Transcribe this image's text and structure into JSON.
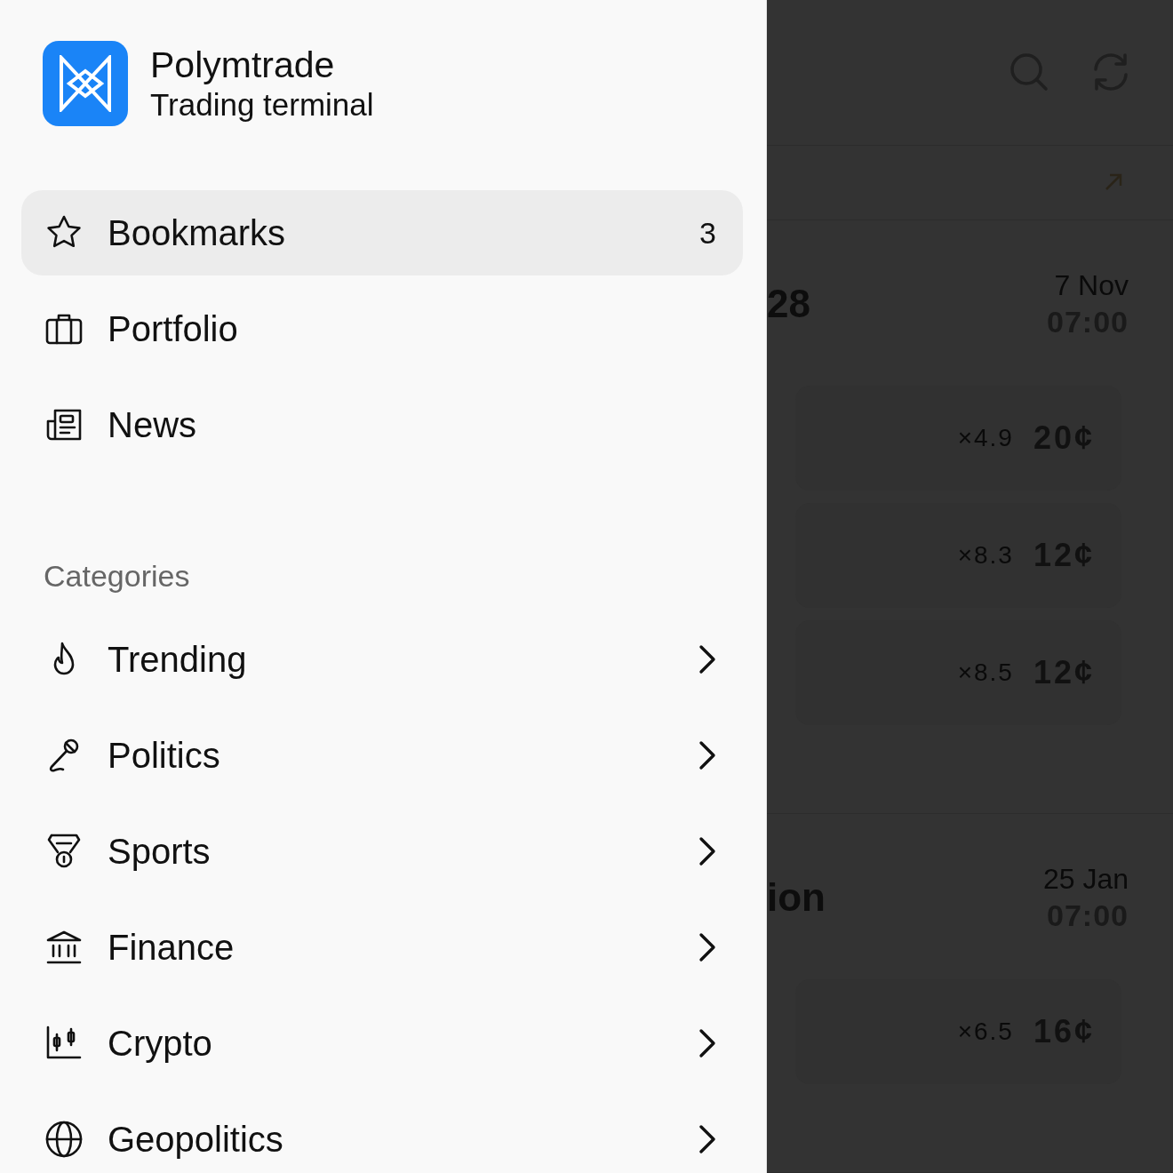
{
  "app": {
    "name": "Polymtrade",
    "subtitle": "Trading terminal"
  },
  "nav": [
    {
      "kind": "bookmarks",
      "label": "Bookmarks",
      "count": "3",
      "selected": true
    },
    {
      "kind": "portfolio",
      "label": "Portfolio",
      "selected": false
    },
    {
      "kind": "news",
      "label": "News",
      "selected": false
    }
  ],
  "categories": {
    "title": "Categories",
    "items": [
      {
        "kind": "trending",
        "label": "Trending"
      },
      {
        "kind": "politics",
        "label": "Politics"
      },
      {
        "kind": "sports",
        "label": "Sports"
      },
      {
        "kind": "finance",
        "label": "Finance"
      },
      {
        "kind": "crypto",
        "label": "Crypto"
      },
      {
        "kind": "geopolitics",
        "label": "Geopolitics"
      }
    ]
  },
  "background": {
    "events": [
      {
        "title": "28",
        "date": "7 Nov",
        "time": "07:00",
        "outcomes": [
          {
            "multiplier": "×4.9",
            "price": "20¢"
          },
          {
            "multiplier": "×8.3",
            "price": "12¢"
          },
          {
            "multiplier": "×8.5",
            "price": "12¢"
          }
        ]
      },
      {
        "title": "ion",
        "date": "25 Jan",
        "time": "07:00",
        "outcomes": [
          {
            "multiplier": "×6.5",
            "price": "16¢"
          }
        ]
      }
    ]
  }
}
